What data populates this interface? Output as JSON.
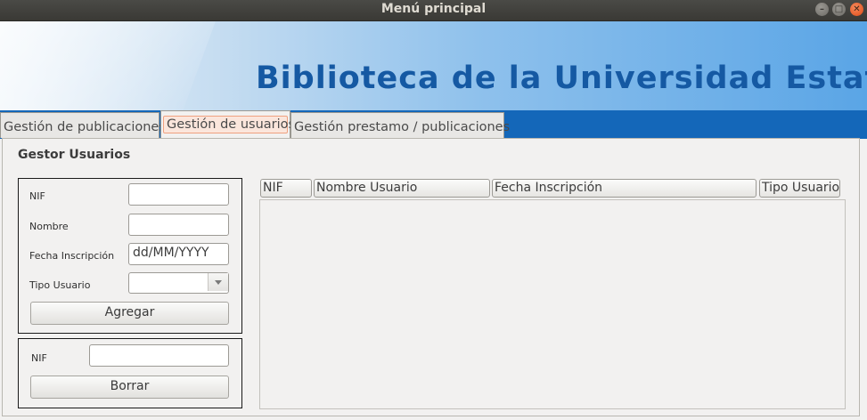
{
  "window": {
    "title": "Menú principal"
  },
  "banner": {
    "title": "Biblioteca de la Universidad Estatal"
  },
  "tabs": [
    {
      "label": "Gestión de publicaciones"
    },
    {
      "label": "Gestión de usuarios"
    },
    {
      "label": "Gestión prestamo / publicaciones"
    }
  ],
  "panel": {
    "title": "Gestor Usuarios",
    "add_form": {
      "nif_label": "NIF",
      "nif_value": "",
      "nombre_label": "Nombre",
      "nombre_value": "",
      "fecha_label": "Fecha Inscripción",
      "fecha_value": "dd/MM/YYYY",
      "tipo_label": "Tipo Usuario",
      "tipo_value": "",
      "add_button": "Agregar"
    },
    "delete_form": {
      "nif_label": "NIF",
      "nif_value": "",
      "delete_button": "Borrar"
    },
    "table": {
      "columns": [
        "NIF",
        "Nombre Usuario",
        "Fecha Inscripción",
        "Tipo Usuario"
      ],
      "rows": []
    }
  }
}
